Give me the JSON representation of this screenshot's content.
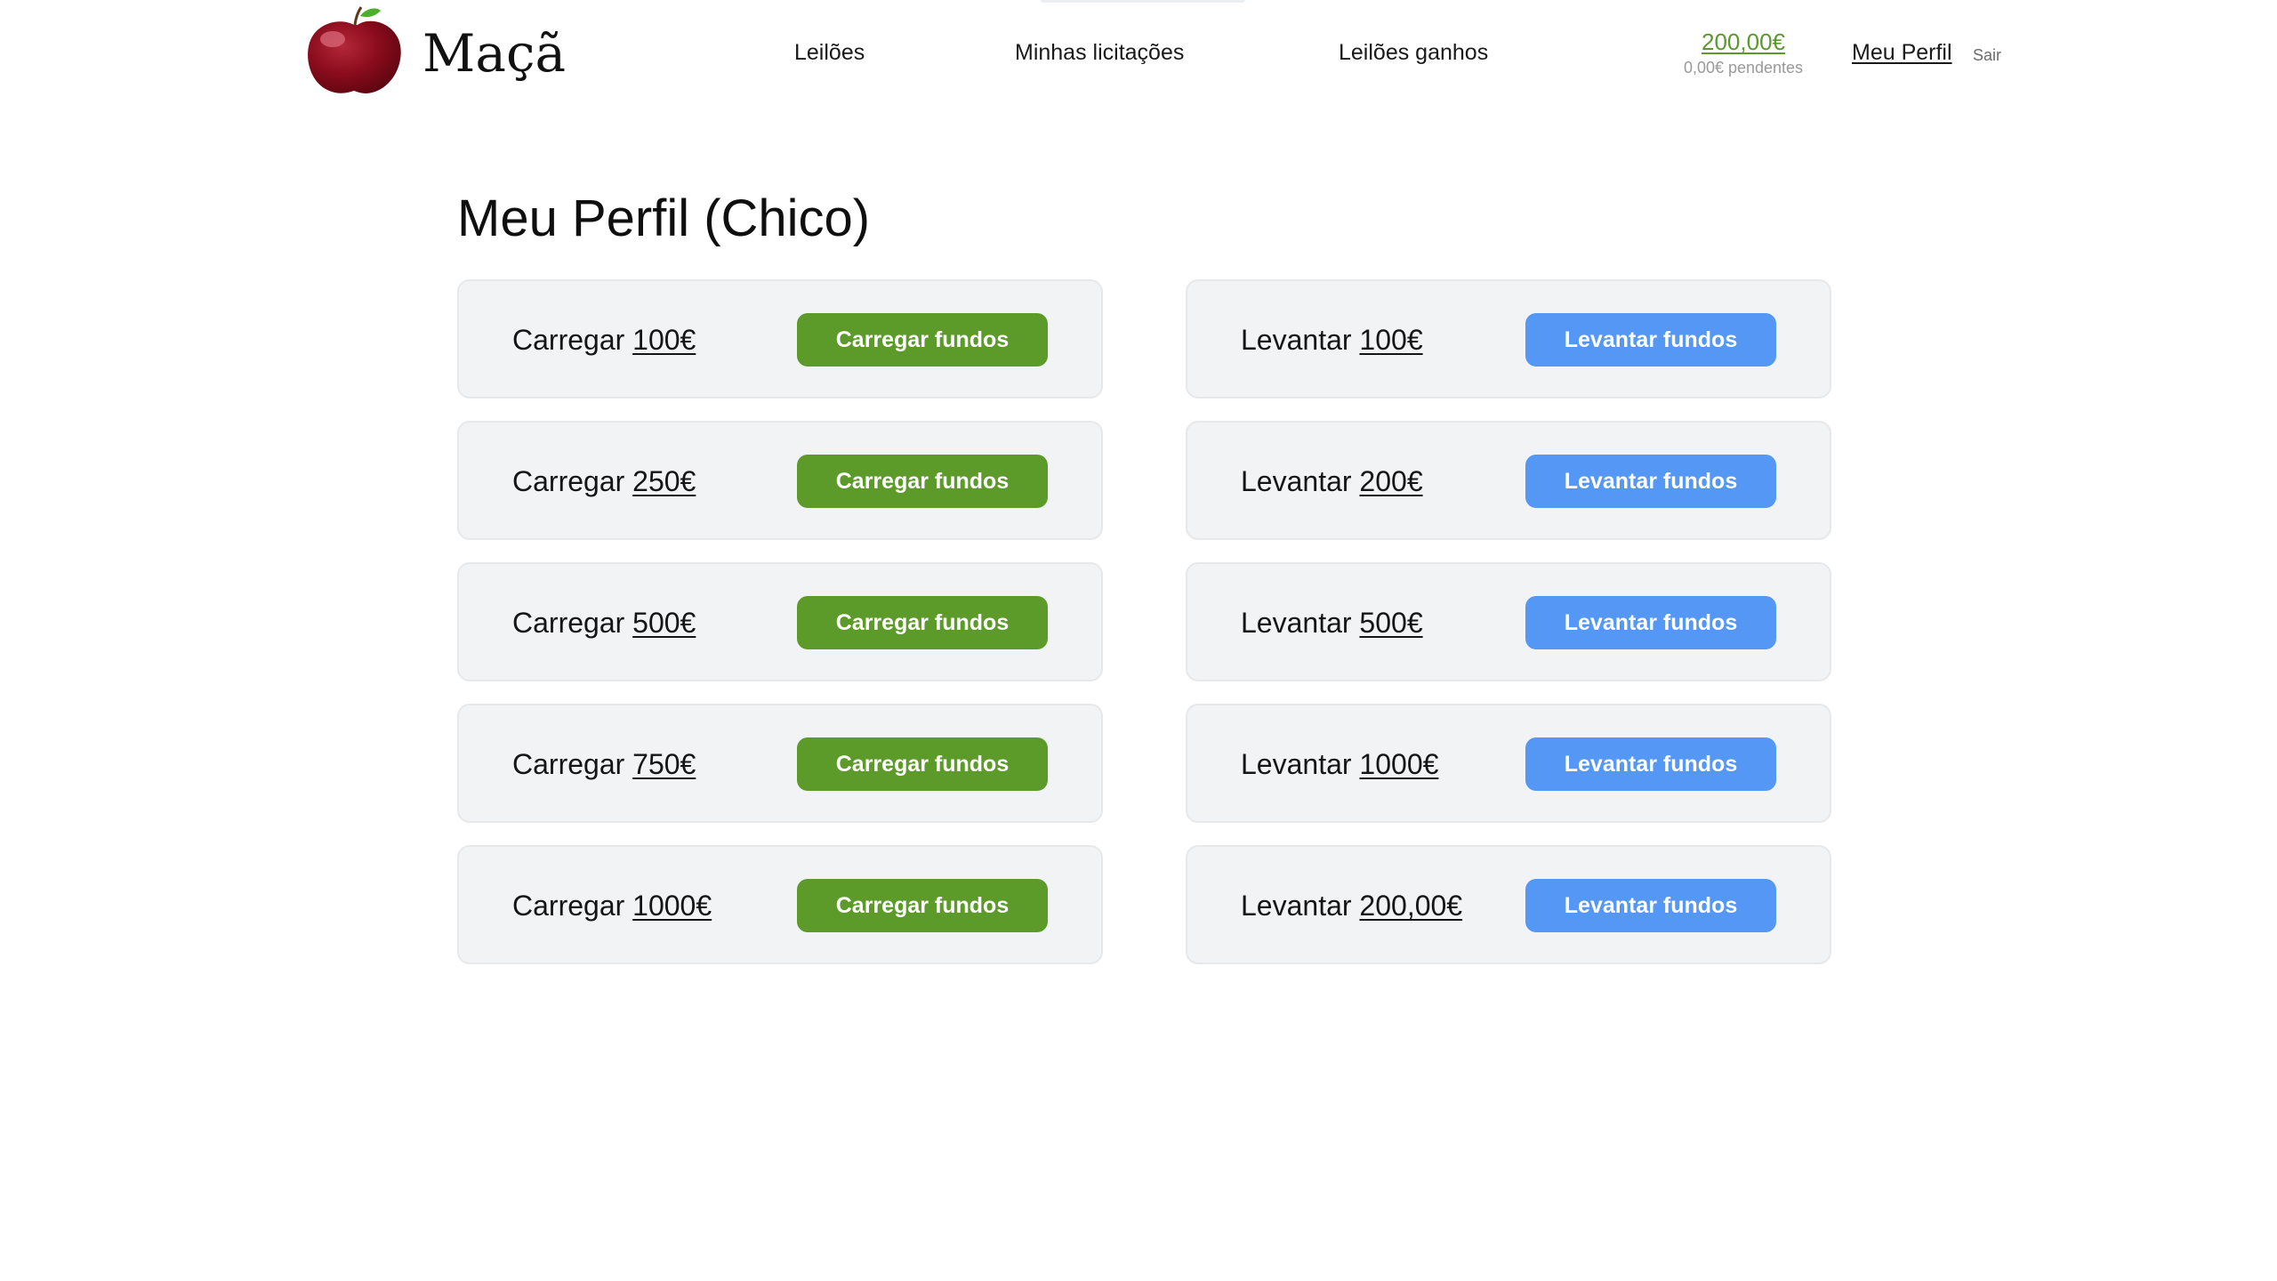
{
  "brand": {
    "name": "Maçã",
    "logo_icon": "apple-icon"
  },
  "nav": {
    "items": [
      {
        "label": "Leilões"
      },
      {
        "label": "Minhas licitações"
      },
      {
        "label": "Leilões ganhos"
      }
    ]
  },
  "account": {
    "balance": "200,00€",
    "pending": "0,00€ pendentes",
    "profile_label": "Meu Perfil",
    "logout_label": "Sair"
  },
  "page": {
    "title": "Meu Perfil (Chico)"
  },
  "load_funds": {
    "prefix": "Carregar",
    "button_label": "Carregar fundos",
    "amounts": [
      "100€",
      "250€",
      "500€",
      "750€",
      "1000€"
    ]
  },
  "withdraw_funds": {
    "prefix": "Levantar",
    "button_label": "Levantar fundos",
    "amounts": [
      "100€",
      "200€",
      "500€",
      "1000€",
      "200,00€"
    ]
  },
  "colors": {
    "load_button": "#5c9a2a",
    "withdraw_button": "#5597f5",
    "balance_text": "#5a9a2a",
    "card_background": "#f2f3f5"
  }
}
